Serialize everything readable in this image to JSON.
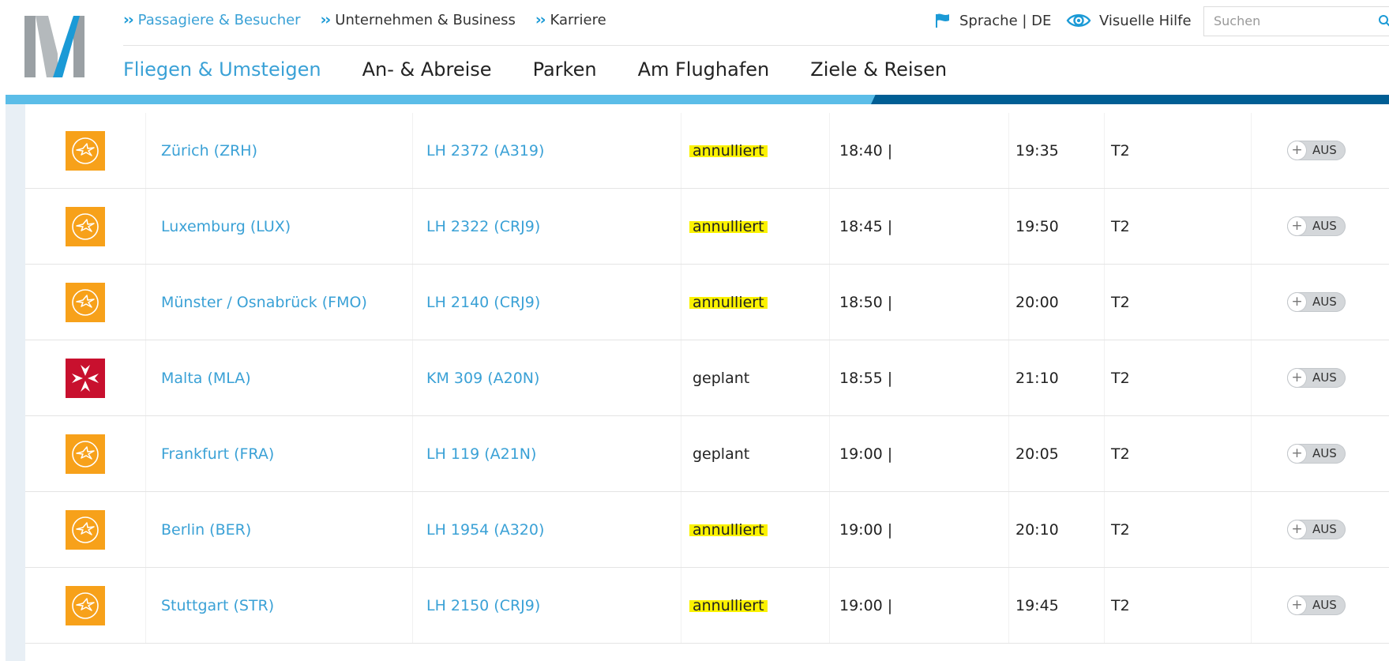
{
  "header": {
    "top_links": [
      {
        "label": "Passagiere & Besucher",
        "active": true
      },
      {
        "label": "Unternehmen & Business",
        "active": false
      },
      {
        "label": "Karriere",
        "active": false
      }
    ],
    "language": "Sprache | DE",
    "visual_help": "Visuelle Hilfe",
    "search_placeholder": "Suchen",
    "main_nav": [
      {
        "label": "Fliegen & Umsteigen",
        "active": true
      },
      {
        "label": "An- & Abreise",
        "active": false
      },
      {
        "label": "Parken",
        "active": false
      },
      {
        "label": "Am Flughafen",
        "active": false
      },
      {
        "label": "Ziele & Reisen",
        "active": false
      }
    ]
  },
  "colors": {
    "accent": "#3aa1d6",
    "bar_light": "#5bbde8",
    "bar_dark": "#005e94",
    "lufthansa_orange": "#f7a11a",
    "air_malta_red": "#c8102e",
    "status_highlight": "#fbf200"
  },
  "flights": [
    {
      "airline_icon": "lufthansa-crane-icon",
      "destination": "Zürich (ZRH)",
      "flight": "LH 2372 (A319)",
      "status": "annulliert",
      "cancelled": true,
      "departure": "18:40 |",
      "arrival": "19:35",
      "terminal": "T2",
      "toggle": "AUS"
    },
    {
      "airline_icon": "lufthansa-crane-icon",
      "destination": "Luxemburg (LUX)",
      "flight": "LH 2322 (CRJ9)",
      "status": "annulliert",
      "cancelled": true,
      "departure": "18:45 |",
      "arrival": "19:50",
      "terminal": "T2",
      "toggle": "AUS"
    },
    {
      "airline_icon": "lufthansa-crane-icon",
      "destination": "Münster / Osnabrück (FMO)",
      "flight": "LH 2140 (CRJ9)",
      "status": "annulliert",
      "cancelled": true,
      "departure": "18:50 |",
      "arrival": "20:00",
      "terminal": "T2",
      "toggle": "AUS"
    },
    {
      "airline_icon": "air-malta-cross-icon",
      "destination": "Malta (MLA)",
      "flight": "KM 309 (A20N)",
      "status": "geplant",
      "cancelled": false,
      "departure": "18:55 |",
      "arrival": "21:10",
      "terminal": "T2",
      "toggle": "AUS"
    },
    {
      "airline_icon": "lufthansa-crane-icon",
      "destination": "Frankfurt (FRA)",
      "flight": "LH 119 (A21N)",
      "status": "geplant",
      "cancelled": false,
      "departure": "19:00 |",
      "arrival": "20:05",
      "terminal": "T2",
      "toggle": "AUS"
    },
    {
      "airline_icon": "lufthansa-crane-icon",
      "destination": "Berlin (BER)",
      "flight": "LH 1954 (A320)",
      "status": "annulliert",
      "cancelled": true,
      "departure": "19:00 |",
      "arrival": "20:10",
      "terminal": "T2",
      "toggle": "AUS"
    },
    {
      "airline_icon": "lufthansa-crane-icon",
      "destination": "Stuttgart (STR)",
      "flight": "LH 2150 (CRJ9)",
      "status": "annulliert",
      "cancelled": true,
      "departure": "19:00 |",
      "arrival": "19:45",
      "terminal": "T2",
      "toggle": "AUS"
    }
  ]
}
